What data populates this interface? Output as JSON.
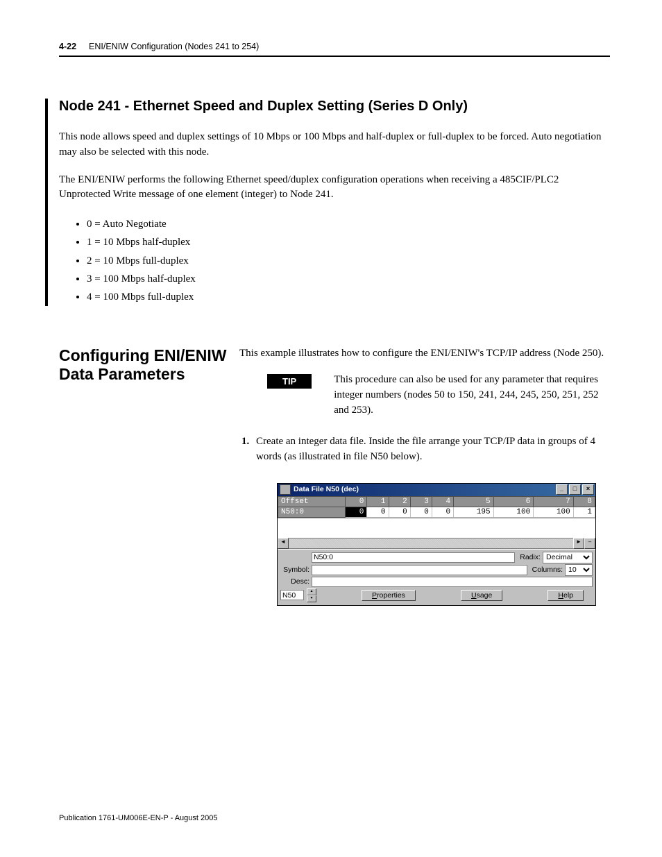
{
  "header": {
    "page_number": "4-22",
    "running_title": "ENI/ENIW Configuration (Nodes 241 to 254)"
  },
  "section1": {
    "heading": "Node 241 - Ethernet Speed and Duplex Setting (Series D Only)",
    "para1": "This node allows speed and duplex settings of 10 Mbps or 100 Mbps and half-duplex or full-duplex to be forced. Auto negotiation may also be selected with this node.",
    "para2": "The ENI/ENIW performs the following Ethernet speed/duplex configuration operations when receiving a 485CIF/PLC2 Unprotected Write message of one element (integer) to Node 241.",
    "bullets": [
      "0 = Auto Negotiate",
      "1 = 10 Mbps half-duplex",
      "2 = 10 Mbps full-duplex",
      "3 = 100 Mbps half-duplex",
      "4 = 100 Mbps full-duplex"
    ]
  },
  "section2": {
    "heading": "Configuring ENI/ENIW Data Parameters",
    "intro": "This example illustrates how to configure the ENI/ENIW's TCP/IP address (Node 250).",
    "tip_label": "TIP",
    "tip_text": "This procedure can also be used for any parameter that requires integer numbers (nodes 50 to 150, 241, 244, 245, 250, 251, 252 and 253).",
    "step1": "Create an integer data file. Inside the file arrange your TCP/IP data in groups of 4 words (as illustrated in file N50 below)."
  },
  "window": {
    "title": "Data File N50 (dec)",
    "columns": [
      "Offset",
      "0",
      "1",
      "2",
      "3",
      "4",
      "5",
      "6",
      "7",
      "8"
    ],
    "rows": [
      {
        "label": "N50:0",
        "cells": [
          "0",
          "0",
          "0",
          "0",
          "0",
          "195",
          "100",
          "100",
          "1"
        ]
      }
    ],
    "addr_label": "",
    "addr_value": "N50:0",
    "radix_label": "Radix:",
    "radix_value": "Decimal",
    "symbol_label": "Symbol:",
    "symbol_value": "",
    "columns_label": "Columns:",
    "columns_value": "10",
    "desc_label": "Desc:",
    "desc_value": "",
    "file_value": "N50",
    "btn_properties": "Properties",
    "btn_usage": "Usage",
    "btn_help": "Help"
  },
  "footer": {
    "publication": "Publication 1761-UM006E-EN-P - August 2005"
  }
}
